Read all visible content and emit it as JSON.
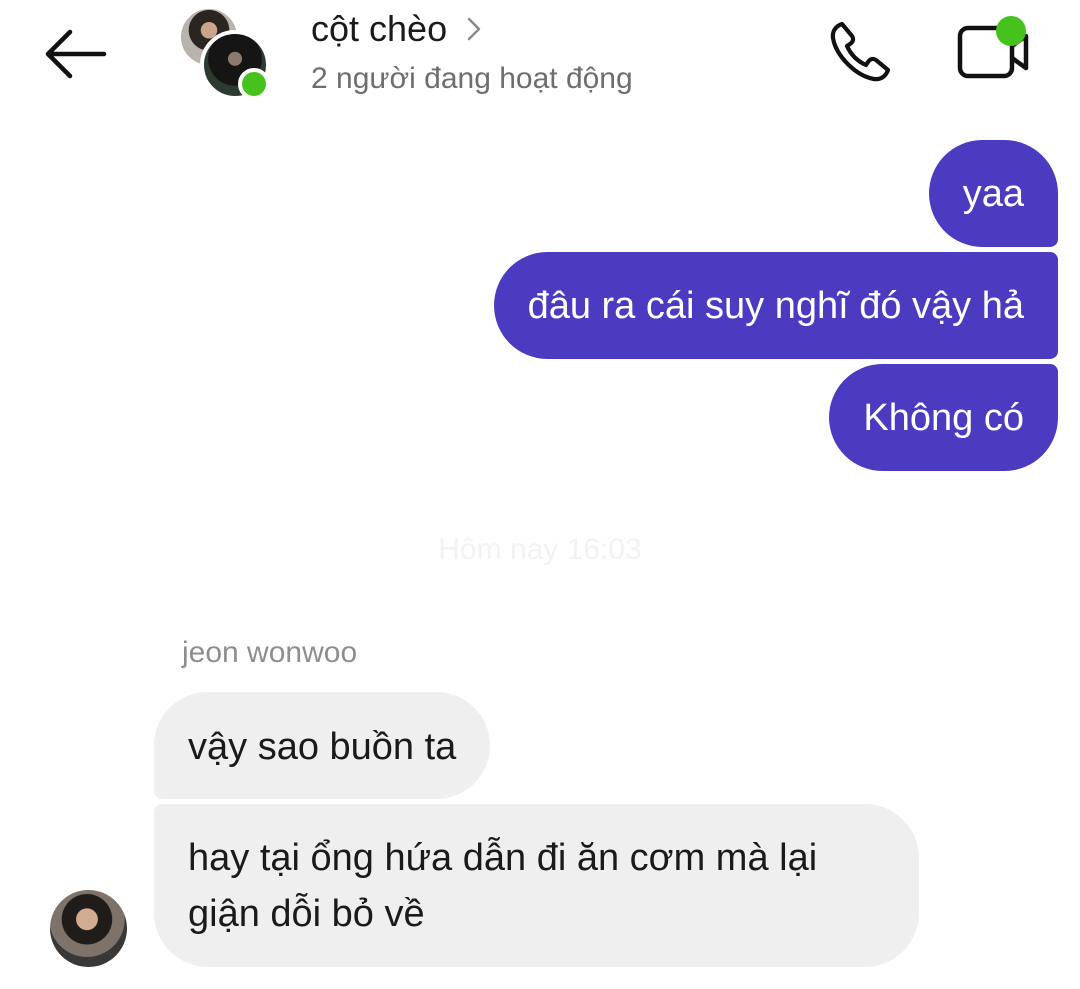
{
  "header": {
    "back_icon": "arrow-left-icon",
    "title": "cột chèo",
    "subtitle": "2 người đang hoạt động",
    "phone_icon": "phone-icon",
    "video_icon": "video-camera-icon",
    "online_color": "#46c21d"
  },
  "messages": {
    "outgoing": [
      {
        "text": "yaa"
      },
      {
        "text": "đâu ra cái suy nghĩ đó vậy hả"
      },
      {
        "text": "Không có"
      }
    ],
    "timestamp": "Hôm nay 16:03",
    "sender_name": "jeon wonwoo",
    "incoming": [
      {
        "text": "vậy sao buồn ta"
      },
      {
        "text": "hay tại ổng hứa dẫn đi ăn cơm mà lại giận dỗi bỏ về"
      }
    ]
  },
  "colors": {
    "outgoing_bubble": "#4b3bc0",
    "incoming_bubble": "#efefef"
  }
}
